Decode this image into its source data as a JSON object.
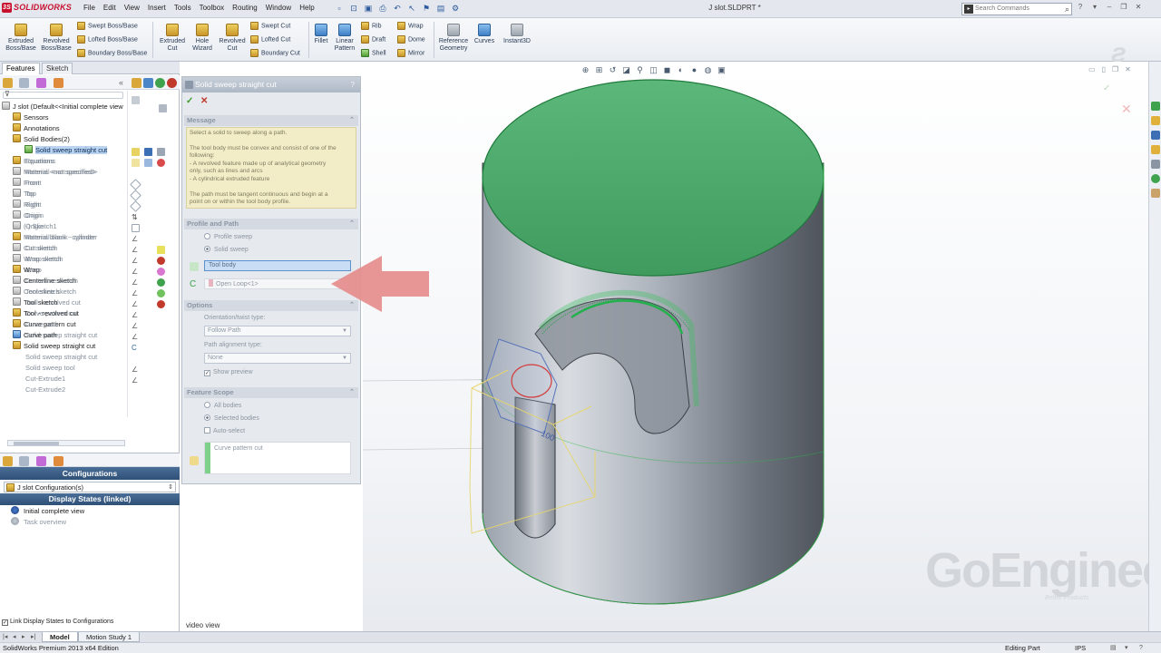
{
  "app": {
    "logo_text": "SOLIDWORKS",
    "document_title": "J slot.SLDPRT *",
    "search_placeholder": "Search Commands"
  },
  "menus": [
    "File",
    "Edit",
    "View",
    "Insert",
    "Tools",
    "Toolbox",
    "Routing",
    "Window",
    "Help"
  ],
  "command_manager": {
    "extruded_boss": "Extruded Boss/Base",
    "revolved_boss": "Revolved Boss/Base",
    "swept_boss": "Swept Boss/Base",
    "lofted_boss": "Lofted Boss/Base",
    "boundary_boss": "Boundary Boss/Base",
    "extruded_cut": "Extruded Cut",
    "hole_wizard": "Hole Wizard",
    "revolved_cut": "Revolved Cut",
    "swept_cut": "Swept Cut",
    "lofted_cut": "Lofted Cut",
    "boundary_cut": "Boundary Cut",
    "fillet": "Fillet",
    "linear_pattern": "Linear Pattern",
    "rib": "Rib",
    "draft": "Draft",
    "shell": "Shell",
    "wrap": "Wrap",
    "dome": "Dome",
    "mirror": "Mirror",
    "reference_geometry": "Reference Geometry",
    "curves": "Curves",
    "instant3d": "Instant3D"
  },
  "left_panel": {
    "tabs": [
      "Features",
      "Sketch"
    ],
    "tree_root": "J slot  (Default<<Initial complete view",
    "tree": [
      {
        "label": "Sensors",
        "icon": "folder"
      },
      {
        "label": "Annotations",
        "icon": "folder"
      },
      {
        "label": "Solid Bodies(2)",
        "icon": "folder"
      },
      {
        "label": "Solid sweep straight cut",
        "icon": "body"
      },
      {
        "label": "Equations",
        "icon": "equations"
      },
      {
        "label": "Material <not specified>",
        "icon": "material"
      },
      {
        "label": "Front",
        "icon": "plane"
      },
      {
        "label": "Top",
        "icon": "plane"
      },
      {
        "label": "Right",
        "icon": "plane"
      },
      {
        "label": "Origin",
        "icon": "origin"
      },
      {
        "label": "(-) Sketch1",
        "icon": "sketch"
      },
      {
        "label": "Material blank - cylinder",
        "icon": "feature"
      },
      {
        "label": "Cut sketch",
        "icon": "sketch"
      },
      {
        "label": "Wrap sketch",
        "icon": "sketch"
      },
      {
        "label": "Wrap",
        "icon": "feature"
      },
      {
        "label": "Centerline sketch",
        "icon": "sketch"
      },
      {
        "label": "Centerline sketch",
        "icon": "sketch"
      },
      {
        "label": "Tool sketch",
        "icon": "sketch"
      },
      {
        "label": "Tool - revolved cut",
        "icon": "feature"
      },
      {
        "label": "Curve pattern cut",
        "icon": "feature"
      },
      {
        "label": "Curve path",
        "icon": "curve"
      },
      {
        "label": "Solid sweep straight cut",
        "icon": "feature"
      }
    ],
    "overlay_ghost": [
      "Equations",
      "Material <not specified>",
      "Front",
      "Top",
      "Right",
      "Origin",
      "Origin",
      "Material blank - cylinder",
      "Cut sketch",
      "Wrap sketch",
      "Wrap",
      "Centerline sketch",
      "Tool sketch",
      "Tool - revolved cut",
      "Curve pattern cut",
      "Curve path",
      "Solid sweep straight cut",
      "Solid sweep straight cut",
      "Solid sweep tool",
      "Cut-Extrude1",
      "Cut-Extrude2"
    ],
    "configurations_header": "Configurations",
    "configuration_item": "J slot Configuration(s)",
    "display_states_header": "Display States (linked)",
    "display_states": [
      "Initial complete view",
      "Task overview"
    ],
    "link_checkbox": "Link Display States to Configurations"
  },
  "property_manager": {
    "title": "Solid sweep straight cut",
    "message_section": "Message",
    "message_text": [
      "Select a solid to sweep along a path.",
      "",
      "The tool body must be convex and consist of one of the",
      "following:",
      "  - A revolved feature made up of analytical geometry",
      "only, such as lines and arcs",
      "  - A cylindrical extruded feature",
      "",
      "The path must be tangent continuous and begin at a",
      "point on or within the tool body profile."
    ],
    "profile_path_section": "Profile and Path",
    "profile_sweep": "Profile sweep",
    "solid_sweep": "Solid sweep",
    "tool_body": "Tool body",
    "open_loop": "Open Loop<1>",
    "options_section": "Options",
    "orientation_label": "Orientation/twist type:",
    "orientation_value": "Follow Path",
    "path_alignment_label": "Path alignment type:",
    "path_alignment_value": "None",
    "show_preview": "Show preview",
    "feature_scope_section": "Feature Scope",
    "all_bodies": "All bodies",
    "selected_bodies": "Selected bodies",
    "auto_select": "Auto-select",
    "scope_body": "Curve pattern cut"
  },
  "graphics": {
    "watermark": "GoEngineer",
    "watermark_sub": "Better Products",
    "video_view": "video view",
    "tool_label": "100"
  },
  "bottom_tabs": [
    "Model",
    "Motion Study 1"
  ],
  "status_bar": {
    "version": "SolidWorks Premium 2013 x64 Edition",
    "mode": "Editing Part",
    "units": "IPS"
  },
  "colors": {
    "accent_red": "#c8102e",
    "selection_green": "#2fb54a",
    "arrow_red": "#e58a8a",
    "header_blue": "#2f5077"
  }
}
